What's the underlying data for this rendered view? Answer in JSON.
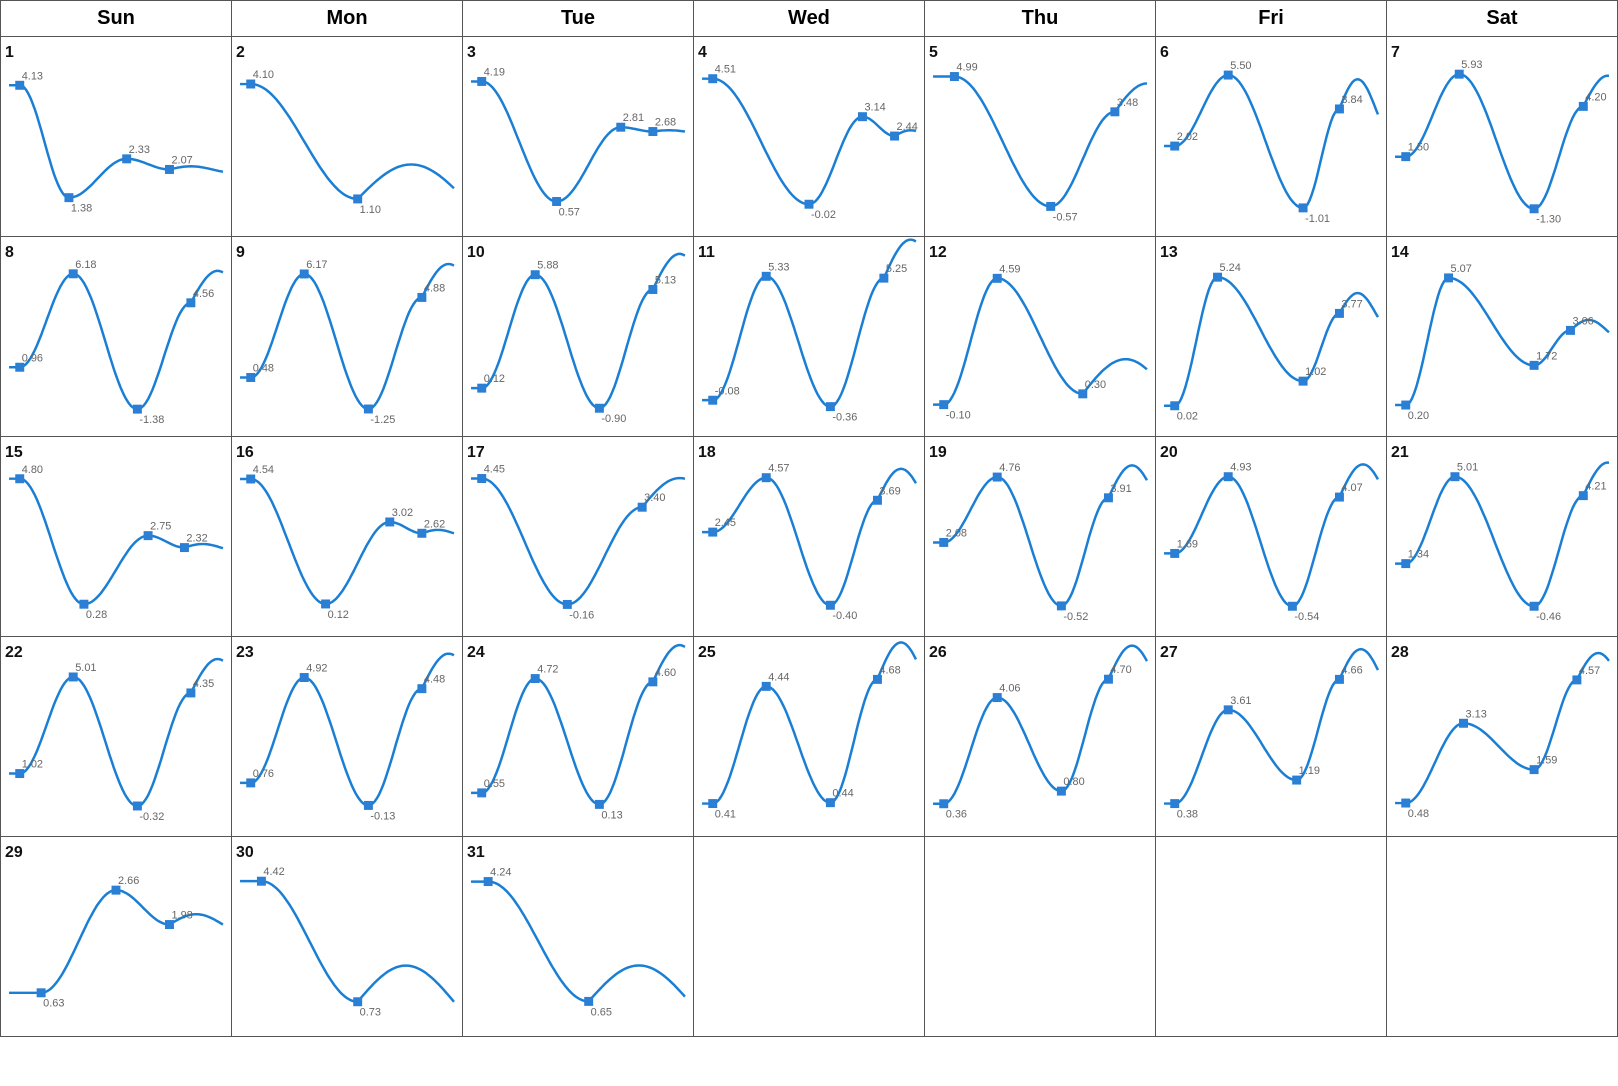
{
  "headers": [
    "Sun",
    "Mon",
    "Tue",
    "Wed",
    "Thu",
    "Fri",
    "Sat"
  ],
  "weeks": [
    [
      {
        "day": 1,
        "values": [
          4.13,
          1.38,
          2.33,
          2.07
        ],
        "positions": [
          0.05,
          0.28,
          0.55,
          0.75
        ]
      },
      {
        "day": 2,
        "values": [
          4.1,
          1.1
        ],
        "positions": [
          0.05,
          0.55
        ]
      },
      {
        "day": 3,
        "values": [
          4.19,
          0.57,
          2.81,
          2.68
        ],
        "positions": [
          0.05,
          0.4,
          0.7,
          0.85
        ]
      },
      {
        "day": 4,
        "values": [
          4.51,
          -0.02,
          3.14,
          2.44
        ],
        "positions": [
          0.05,
          0.5,
          0.75,
          0.9
        ]
      },
      {
        "day": 5,
        "values": [
          4.99,
          -0.57,
          3.48
        ],
        "positions": [
          0.1,
          0.55,
          0.85
        ]
      },
      {
        "day": 6,
        "values": [
          2.02,
          5.5,
          -1.01,
          3.84
        ],
        "positions": [
          0.05,
          0.3,
          0.65,
          0.82
        ]
      },
      {
        "day": 7,
        "values": [
          1.5,
          5.93,
          -1.3,
          4.2
        ],
        "positions": [
          0.05,
          0.3,
          0.65,
          0.88
        ]
      }
    ],
    [
      {
        "day": 8,
        "values": [
          0.96,
          6.18,
          -1.38,
          4.56
        ],
        "positions": [
          0.05,
          0.3,
          0.6,
          0.85
        ]
      },
      {
        "day": 9,
        "values": [
          0.48,
          6.17,
          -1.25,
          4.88
        ],
        "positions": [
          0.05,
          0.3,
          0.6,
          0.85
        ]
      },
      {
        "day": 10,
        "values": [
          0.12,
          5.88,
          -0.9,
          5.13
        ],
        "positions": [
          0.05,
          0.3,
          0.6,
          0.85
        ]
      },
      {
        "day": 11,
        "values": [
          -0.08,
          5.33,
          -0.36,
          5.25
        ],
        "positions": [
          0.05,
          0.3,
          0.6,
          0.85
        ]
      },
      {
        "day": 12,
        "values": [
          -0.1,
          4.59,
          0.3
        ],
        "positions": [
          0.05,
          0.3,
          0.7
        ]
      },
      {
        "day": 13,
        "values": [
          0.02,
          5.24,
          1.02,
          3.77
        ],
        "positions": [
          0.05,
          0.25,
          0.65,
          0.82
        ]
      },
      {
        "day": 14,
        "values": [
          0.2,
          5.07,
          1.72,
          3.06
        ],
        "positions": [
          0.05,
          0.25,
          0.65,
          0.82
        ]
      }
    ],
    [
      {
        "day": 15,
        "values": [
          4.8,
          0.28,
          2.75,
          2.32
        ],
        "positions": [
          0.05,
          0.35,
          0.65,
          0.82
        ]
      },
      {
        "day": 16,
        "values": [
          4.54,
          0.12,
          3.02,
          2.62
        ],
        "positions": [
          0.05,
          0.4,
          0.7,
          0.85
        ]
      },
      {
        "day": 17,
        "values": [
          4.45,
          -0.16,
          3.4
        ],
        "positions": [
          0.05,
          0.45,
          0.8
        ]
      },
      {
        "day": 18,
        "values": [
          2.45,
          4.57,
          -0.4,
          3.69
        ],
        "positions": [
          0.05,
          0.3,
          0.6,
          0.82
        ]
      },
      {
        "day": 19,
        "values": [
          2.08,
          4.76,
          -0.52,
          3.91
        ],
        "positions": [
          0.05,
          0.3,
          0.6,
          0.82
        ]
      },
      {
        "day": 20,
        "values": [
          1.69,
          4.93,
          -0.54,
          4.07
        ],
        "positions": [
          0.05,
          0.3,
          0.6,
          0.82
        ]
      },
      {
        "day": 21,
        "values": [
          1.34,
          5.01,
          -0.46,
          4.21
        ],
        "positions": [
          0.05,
          0.28,
          0.65,
          0.88
        ]
      }
    ],
    [
      {
        "day": 22,
        "values": [
          1.02,
          5.01,
          -0.32,
          4.35
        ],
        "positions": [
          0.05,
          0.3,
          0.6,
          0.85
        ]
      },
      {
        "day": 23,
        "values": [
          0.76,
          4.92,
          -0.13,
          4.48
        ],
        "positions": [
          0.05,
          0.3,
          0.6,
          0.85
        ]
      },
      {
        "day": 24,
        "values": [
          0.55,
          4.72,
          0.13,
          4.6
        ],
        "positions": [
          0.05,
          0.3,
          0.6,
          0.85
        ]
      },
      {
        "day": 25,
        "values": [
          0.41,
          4.44,
          0.44,
          4.68
        ],
        "positions": [
          0.05,
          0.3,
          0.6,
          0.82
        ]
      },
      {
        "day": 26,
        "values": [
          0.36,
          4.06,
          0.8,
          4.7
        ],
        "positions": [
          0.05,
          0.3,
          0.6,
          0.82
        ]
      },
      {
        "day": 27,
        "values": [
          0.38,
          3.61,
          1.19,
          4.66
        ],
        "positions": [
          0.05,
          0.3,
          0.62,
          0.82
        ]
      },
      {
        "day": 28,
        "values": [
          0.48,
          3.13,
          1.59,
          4.57
        ],
        "positions": [
          0.05,
          0.32,
          0.65,
          0.85
        ]
      }
    ],
    [
      {
        "day": 29,
        "values": [
          0.63,
          2.66,
          1.98
        ],
        "positions": [
          0.15,
          0.5,
          0.75
        ]
      },
      {
        "day": 30,
        "values": [
          4.42,
          0.73
        ],
        "positions": [
          0.1,
          0.55
        ]
      },
      {
        "day": 31,
        "values": [
          4.24,
          0.65
        ],
        "positions": [
          0.08,
          0.55
        ]
      },
      null,
      null,
      null,
      null
    ]
  ]
}
